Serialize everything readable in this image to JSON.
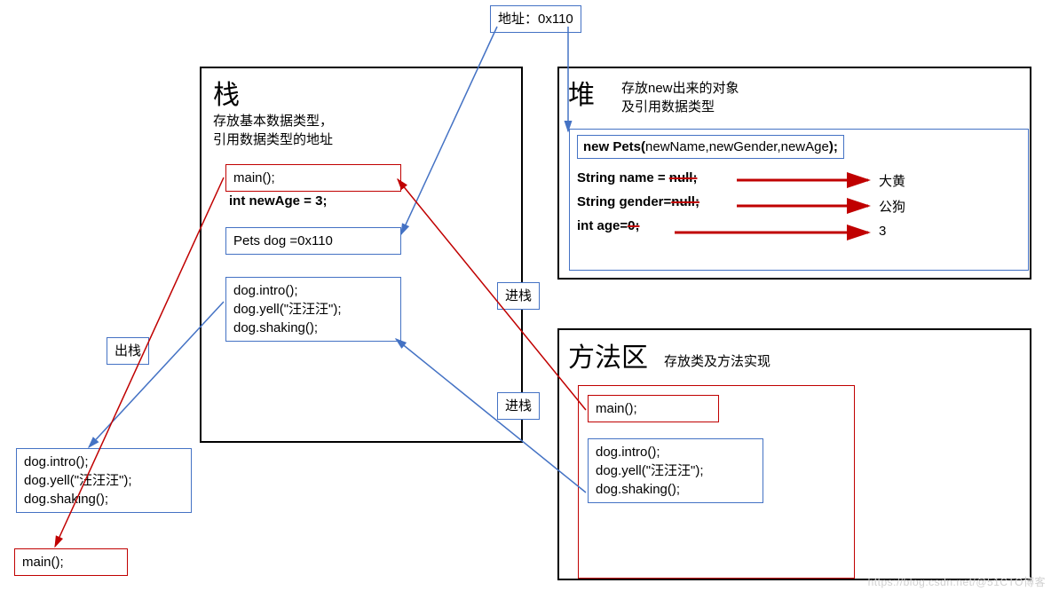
{
  "addressLabel": "地址：0x110",
  "stack": {
    "title": "栈",
    "subtitle1": "存放基本数据类型，",
    "subtitle2": "引用数据类型的地址",
    "mainCall": "main();",
    "newAge": "int newAge = 3;",
    "petsDog": "Pets dog =0x110",
    "dogIntro": "dog.intro();",
    "dogYell": "dog.yell(\"汪汪汪\");",
    "dogShaking": "dog.shaking();"
  },
  "heap": {
    "title": "堆",
    "sub1": "存放new出来的对象",
    "sub2": "及引用数据类型",
    "newPetsPrefix": "new Pets(",
    "newPetsArgs": "newName,newGender,newAge",
    "newPetsSuffix": ");",
    "nameLabel": "String name = ",
    "nameOld": "null;",
    "genderLabel": "String gender=",
    "genderOld": "null;",
    "ageLabel": "int age=",
    "ageOld": "0;",
    "nameNew": "大黄",
    "genderNew": "公狗",
    "ageNew": "3"
  },
  "methodArea": {
    "title": "方法区",
    "sub": "存放类及方法实现",
    "main": "main();",
    "dogIntro": "dog.intro();",
    "dogYell": "dog.yell(\"汪汪汪\");",
    "dogShaking": "dog.shaking();"
  },
  "labels": {
    "popStack": "出栈",
    "pushStack1": "进栈",
    "pushStack2": "进栈"
  },
  "outside": {
    "dogIntro": "dog.intro();",
    "dogYell": "dog.yell(\"汪汪汪\");",
    "dogShaking": "dog.shaking();",
    "main": "main();"
  },
  "watermark": "https://blog.csdn.net/@51CTO博客"
}
